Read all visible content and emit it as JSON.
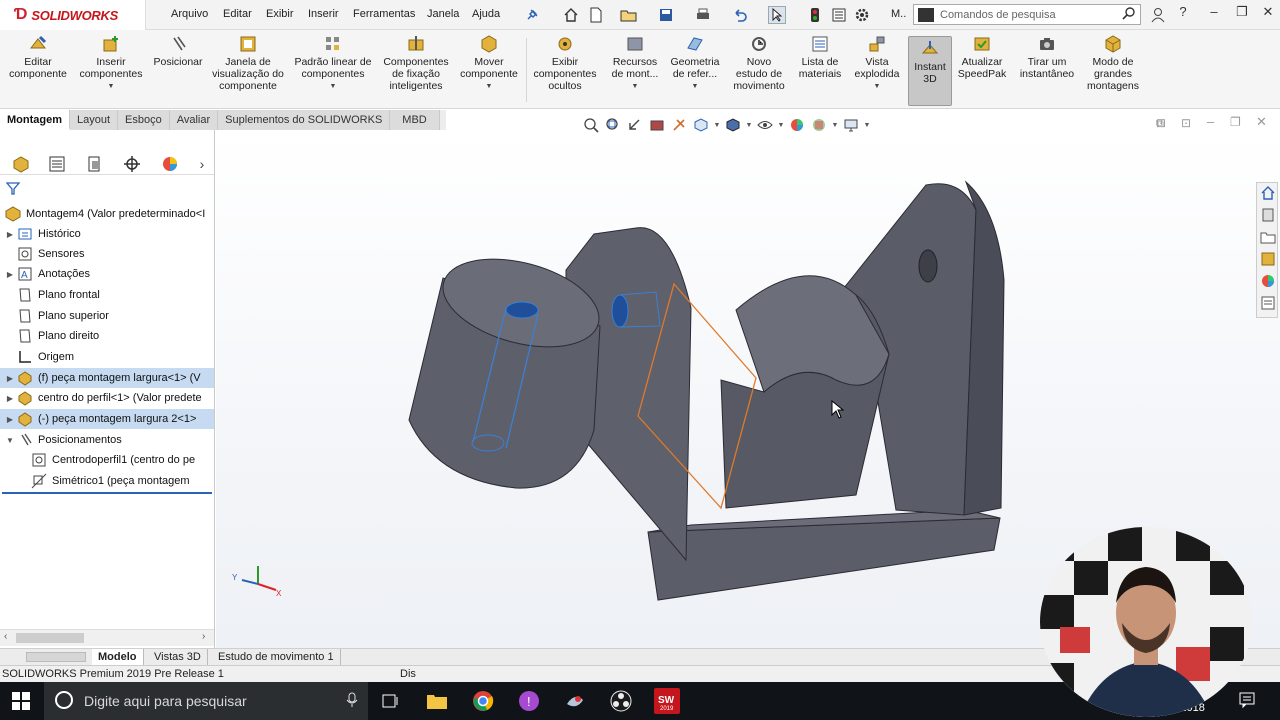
{
  "app": {
    "brand": "SOLIDWORKS",
    "menu": [
      "Arquivo",
      "Editar",
      "Exibir",
      "Inserir",
      "Ferramentas",
      "Janela",
      "Ajuda"
    ],
    "search_placeholder": "Comandos de pesquisa",
    "window_controls": [
      "?",
      "–",
      "❐",
      "✕"
    ],
    "quick_access_more": "M.."
  },
  "ribbon": {
    "buttons": [
      {
        "label": "Editar\ncomponente"
      },
      {
        "label": "Inserir\ncomponentes"
      },
      {
        "label": "Posicionar"
      },
      {
        "label": "Janela de\nvisualização do\ncomponente"
      },
      {
        "label": "Padrão linear de\ncomponentes"
      },
      {
        "label": "Componentes\nde fixação\ninteligentes"
      },
      {
        "label": "Mover\ncomponente"
      },
      {
        "label": "Exibir\ncomponentes\nocultos"
      },
      {
        "label": "Recursos\nde mont..."
      },
      {
        "label": "Geometria\nde refer..."
      },
      {
        "label": "Novo\nestudo de\nmovimento"
      },
      {
        "label": "Lista de\nmateriais"
      },
      {
        "label": "Vista\nexplodida"
      },
      {
        "label": "Instant\n3D"
      },
      {
        "label": "Atualizar\nSpeedPak"
      },
      {
        "label": "Tirar um\ninstantâneo"
      },
      {
        "label": "Modo de\ngrandes\nmontagens"
      }
    ]
  },
  "tabs": [
    "Montagem",
    "Layout",
    "Esboço",
    "Avaliar",
    "Suplementos do SOLIDWORKS",
    "MBD"
  ],
  "tree": {
    "root": "Montagem4  (Valor predeterminado<I",
    "items": [
      {
        "label": "Histórico"
      },
      {
        "label": "Sensores"
      },
      {
        "label": "Anotações"
      },
      {
        "label": "Plano frontal"
      },
      {
        "label": "Plano superior"
      },
      {
        "label": "Plano direito"
      },
      {
        "label": "Origem"
      },
      {
        "label": "(f) peça montagem largura<1> (V"
      },
      {
        "label": "centro do perfil<1> (Valor predete"
      },
      {
        "label": "(-) peça montagem largura 2<1>"
      },
      {
        "label": "Posicionamentos"
      },
      {
        "label": "Centrodoperfil1 (centro do pe"
      },
      {
        "label": "Simétrico1 (peça montagem"
      }
    ]
  },
  "bottom_tabs": [
    "Modelo",
    "Vistas 3D",
    "Estudo de movimento 1"
  ],
  "status": {
    "left": "SOLIDWORKS Premium 2019 Pre Release 1",
    "mid": "Dis"
  },
  "taskbar": {
    "search_placeholder": "Digite aqui para pesquisar",
    "clock_date": "/10/2018"
  },
  "colors": {
    "model_face": "#5b5d69",
    "model_dark": "#484a55",
    "selection_blue": "#3d7fd1",
    "plane_orange": "#e07a2a",
    "brand_red": "#c4161c"
  }
}
